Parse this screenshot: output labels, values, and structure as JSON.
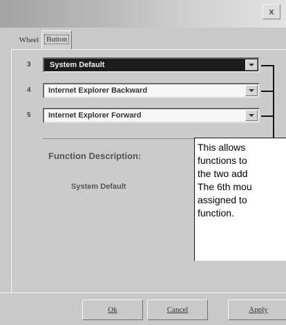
{
  "window": {
    "close_label": "x"
  },
  "tabs": [
    {
      "label": "Wheel",
      "selected": false
    },
    {
      "label": "Button",
      "selected": true
    }
  ],
  "buttons": [
    {
      "number": "3",
      "value": "System Default",
      "selected": true
    },
    {
      "number": "4",
      "value": "Internet Explorer Backward",
      "selected": false
    },
    {
      "number": "5",
      "value": "Internet Explorer Forward",
      "selected": false
    }
  ],
  "function_description": {
    "title": "Function Description:",
    "value": "System Default"
  },
  "callout": {
    "text": "This allows\nfunctions to\nthe two add\nThe 6th mou\nassigned to\nfunction."
  },
  "footer": {
    "ok_label": "Ok",
    "cancel_label": "Cancel",
    "apply_label": "Apply"
  }
}
